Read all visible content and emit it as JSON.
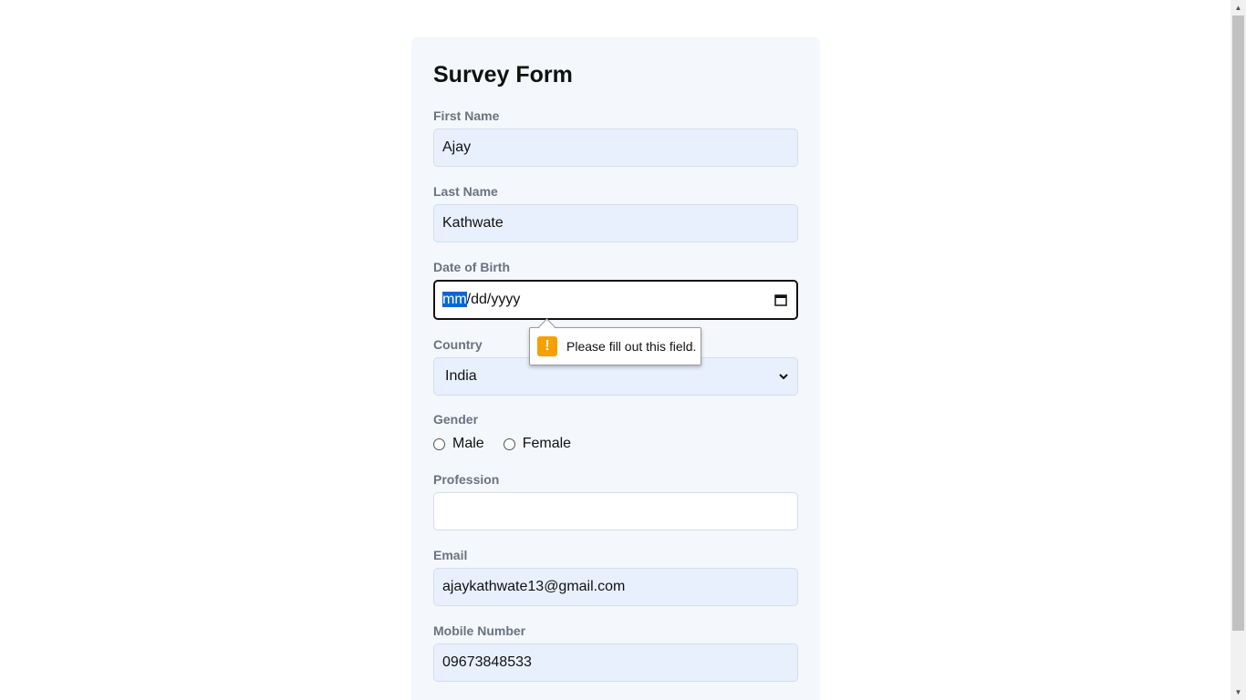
{
  "form": {
    "title": "Survey Form",
    "first_name": {
      "label": "First Name",
      "value": "Ajay"
    },
    "last_name": {
      "label": "Last Name",
      "value": "Kathwate"
    },
    "dob": {
      "label": "Date of Birth",
      "selected_segment": "mm",
      "rest_placeholder": "/dd/yyyy"
    },
    "country": {
      "label": "Country",
      "selected": "India"
    },
    "gender": {
      "label": "Gender",
      "options": [
        "Male",
        "Female"
      ]
    },
    "profession": {
      "label": "Profession",
      "value": ""
    },
    "email": {
      "label": "Email",
      "value": "ajaykathwate13@gmail.com"
    },
    "mobile": {
      "label": "Mobile Number",
      "value": "09673848533"
    }
  },
  "validation_tooltip": {
    "icon": "warning-icon",
    "message": "Please fill out this field."
  },
  "colors": {
    "card_background": "#f4f7fb",
    "autofill_background": "#e8f0fe",
    "label_text": "#6b7280",
    "selection": "#0a66d6",
    "warning": "#f5a000"
  }
}
